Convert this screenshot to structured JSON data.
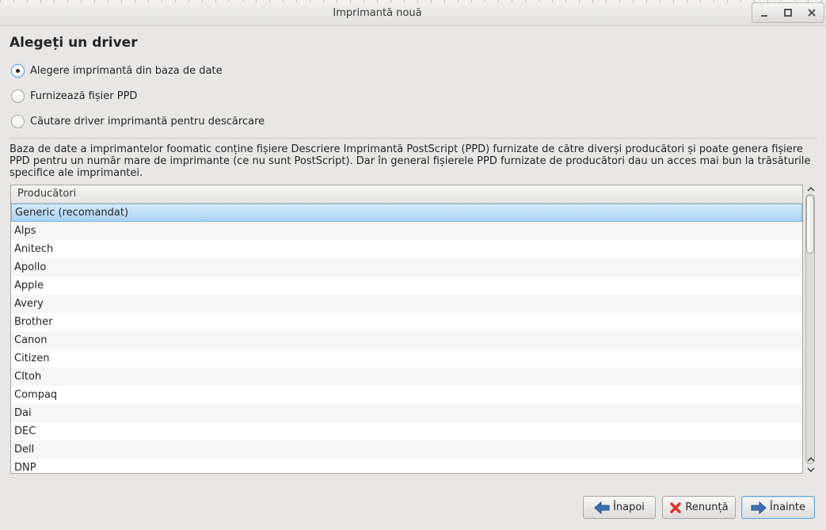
{
  "window": {
    "title": "Imprimantă nouă"
  },
  "page": {
    "heading": "Alegeți un driver",
    "options": [
      {
        "label": "Alegere imprimantă din baza de date",
        "checked": true
      },
      {
        "label": "Furnizează fișier PPD",
        "checked": false
      },
      {
        "label": "Căutare driver imprimantă pentru descărcare",
        "checked": false
      }
    ],
    "description": "Baza de date a imprimantelor foomatic conține fișiere Descriere Imprimantă PostScript (PPD) furnizate de către diverși producători și poate genera fișiere PPD pentru un număr mare de imprimante (ce nu sunt PostScript). Dar în general fișierele PPD furnizate de producători dau un acces mai bun la trăsăturile specifice ale imprimantei."
  },
  "list": {
    "header": "Producători",
    "selected_index": 0,
    "rows": [
      "Generic (recomandat)",
      "Alps",
      "Anitech",
      "Apollo",
      "Apple",
      "Avery",
      "Brother",
      "Canon",
      "Citizen",
      "CItoh",
      "Compaq",
      "Dai",
      "DEC",
      "Dell",
      "DNP"
    ]
  },
  "buttons": {
    "back": "Înapoi",
    "cancel": "Renunță",
    "next": "Înainte"
  },
  "colors": {
    "selection": "#a9d2f3",
    "accent": "#6aa3d8",
    "cancel_icon": "#d8372f",
    "arrow_icon": "#3f6fb4"
  }
}
